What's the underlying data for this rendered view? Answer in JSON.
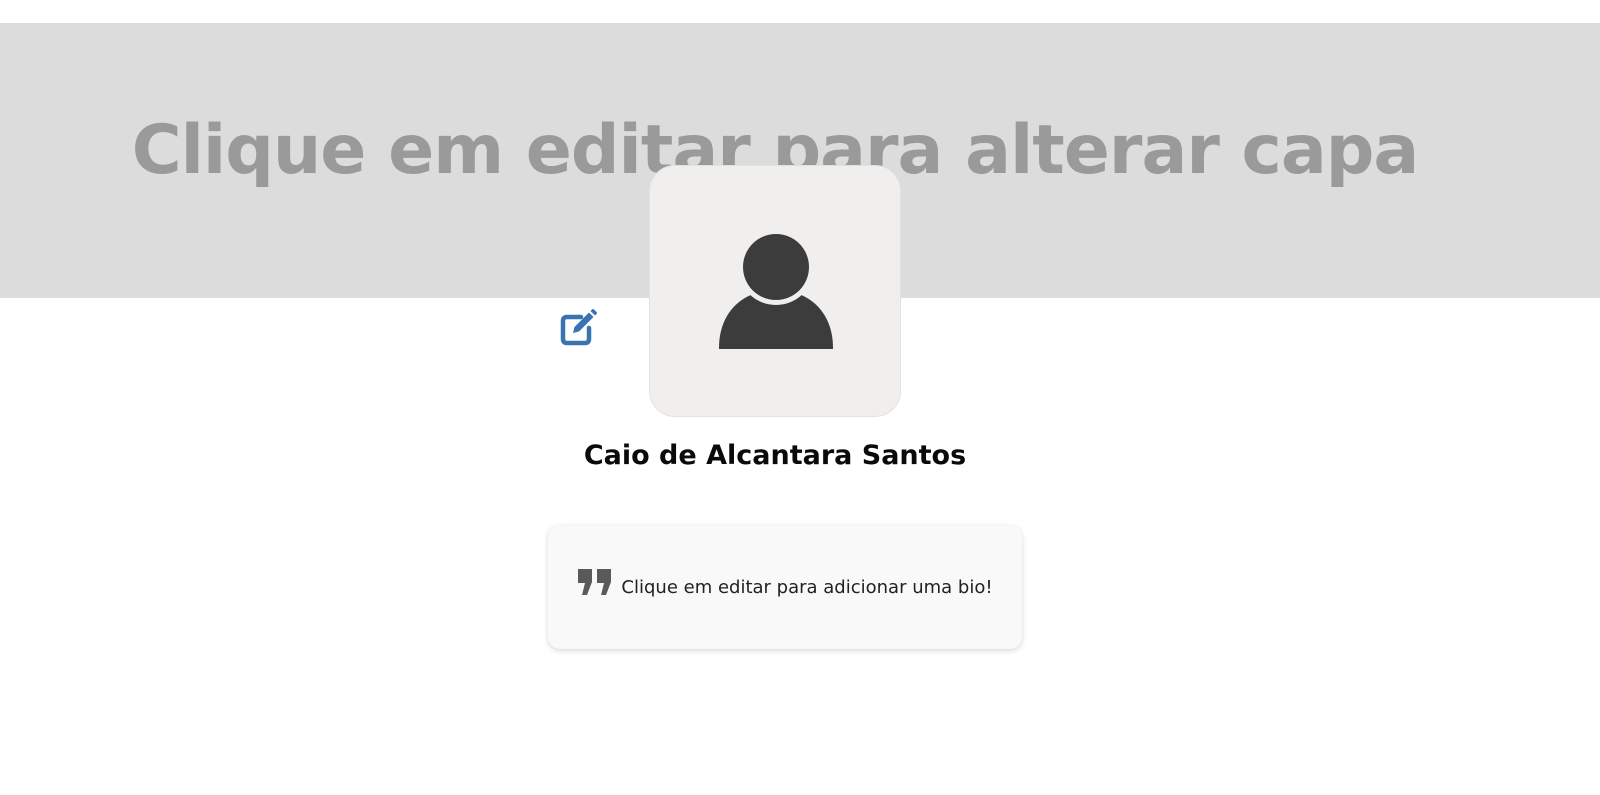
{
  "cover": {
    "placeholder_text": "Clique em editar para alterar capa",
    "background_color": "#dcdcdc",
    "text_color": "#9a9a9a"
  },
  "profile": {
    "avatar_icon": "user-silhouette-icon",
    "edit_icon": "edit-pencil-square-icon",
    "edit_icon_color": "#3a73b3",
    "name": "Caio de Alcantara Santos"
  },
  "bio": {
    "quote_icon": "quote-right-icon",
    "text": "Clique em editar para adicionar uma bio!"
  }
}
